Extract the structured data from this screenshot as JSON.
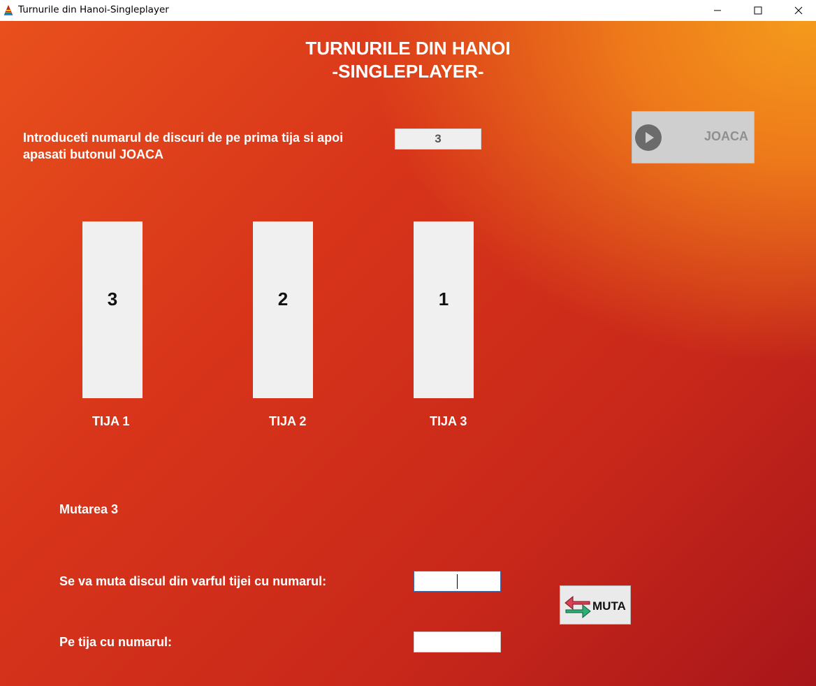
{
  "window": {
    "title": "Turnurile din Hanoi-Singleplayer",
    "icon": "tower-app-icon"
  },
  "header": {
    "line1": "TURNURILE DIN HANOI",
    "line2": "-SINGLEPLAYER-"
  },
  "setup": {
    "instruction": "Introduceti numarul de discuri de pe prima tija si apoi apasati butonul JOACA",
    "disc_count": "3",
    "play_label": "JOACA",
    "play_icon": "play-circle-icon"
  },
  "rods": [
    {
      "label": "TIJA 1",
      "value": "3"
    },
    {
      "label": "TIJA 2",
      "value": "2"
    },
    {
      "label": "TIJA 3",
      "value": "1"
    }
  ],
  "move": {
    "counter": "Mutarea 3",
    "from_label": "Se va muta discul din varful tijei cu numarul:",
    "from_value": "",
    "to_label": "Pe tija cu numarul:",
    "to_value": "",
    "button_label": "MUTA",
    "button_icon": "swap-arrows-icon"
  },
  "colors": {
    "background_top_right": "#f49a1c",
    "background_bottom_left": "#a8161a",
    "text": "#ffffff"
  }
}
